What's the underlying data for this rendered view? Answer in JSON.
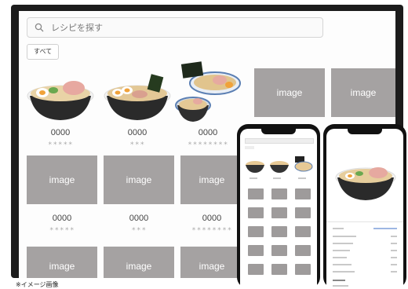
{
  "search": {
    "placeholder": "レシピを探す"
  },
  "filter": {
    "label": "すべて"
  },
  "tile_label": "image",
  "cards_row1": [
    {
      "num": "0000",
      "stars": "＊＊＊＊＊"
    },
    {
      "num": "0000",
      "stars": "＊＊＊"
    },
    {
      "num": "0000",
      "stars": "＊＊＊＊＊＊＊＊"
    }
  ],
  "cards_row2": [
    {
      "num": "0000",
      "stars": "＊＊＊＊＊"
    },
    {
      "num": "0000",
      "stars": "＊＊＊"
    },
    {
      "num": "0000",
      "stars": "＊＊＊＊＊＊＊＊"
    }
  ],
  "caption": "※イメージ画像",
  "colors": {
    "tile": "#a5a2a2",
    "frame": "#1c1c1c"
  }
}
